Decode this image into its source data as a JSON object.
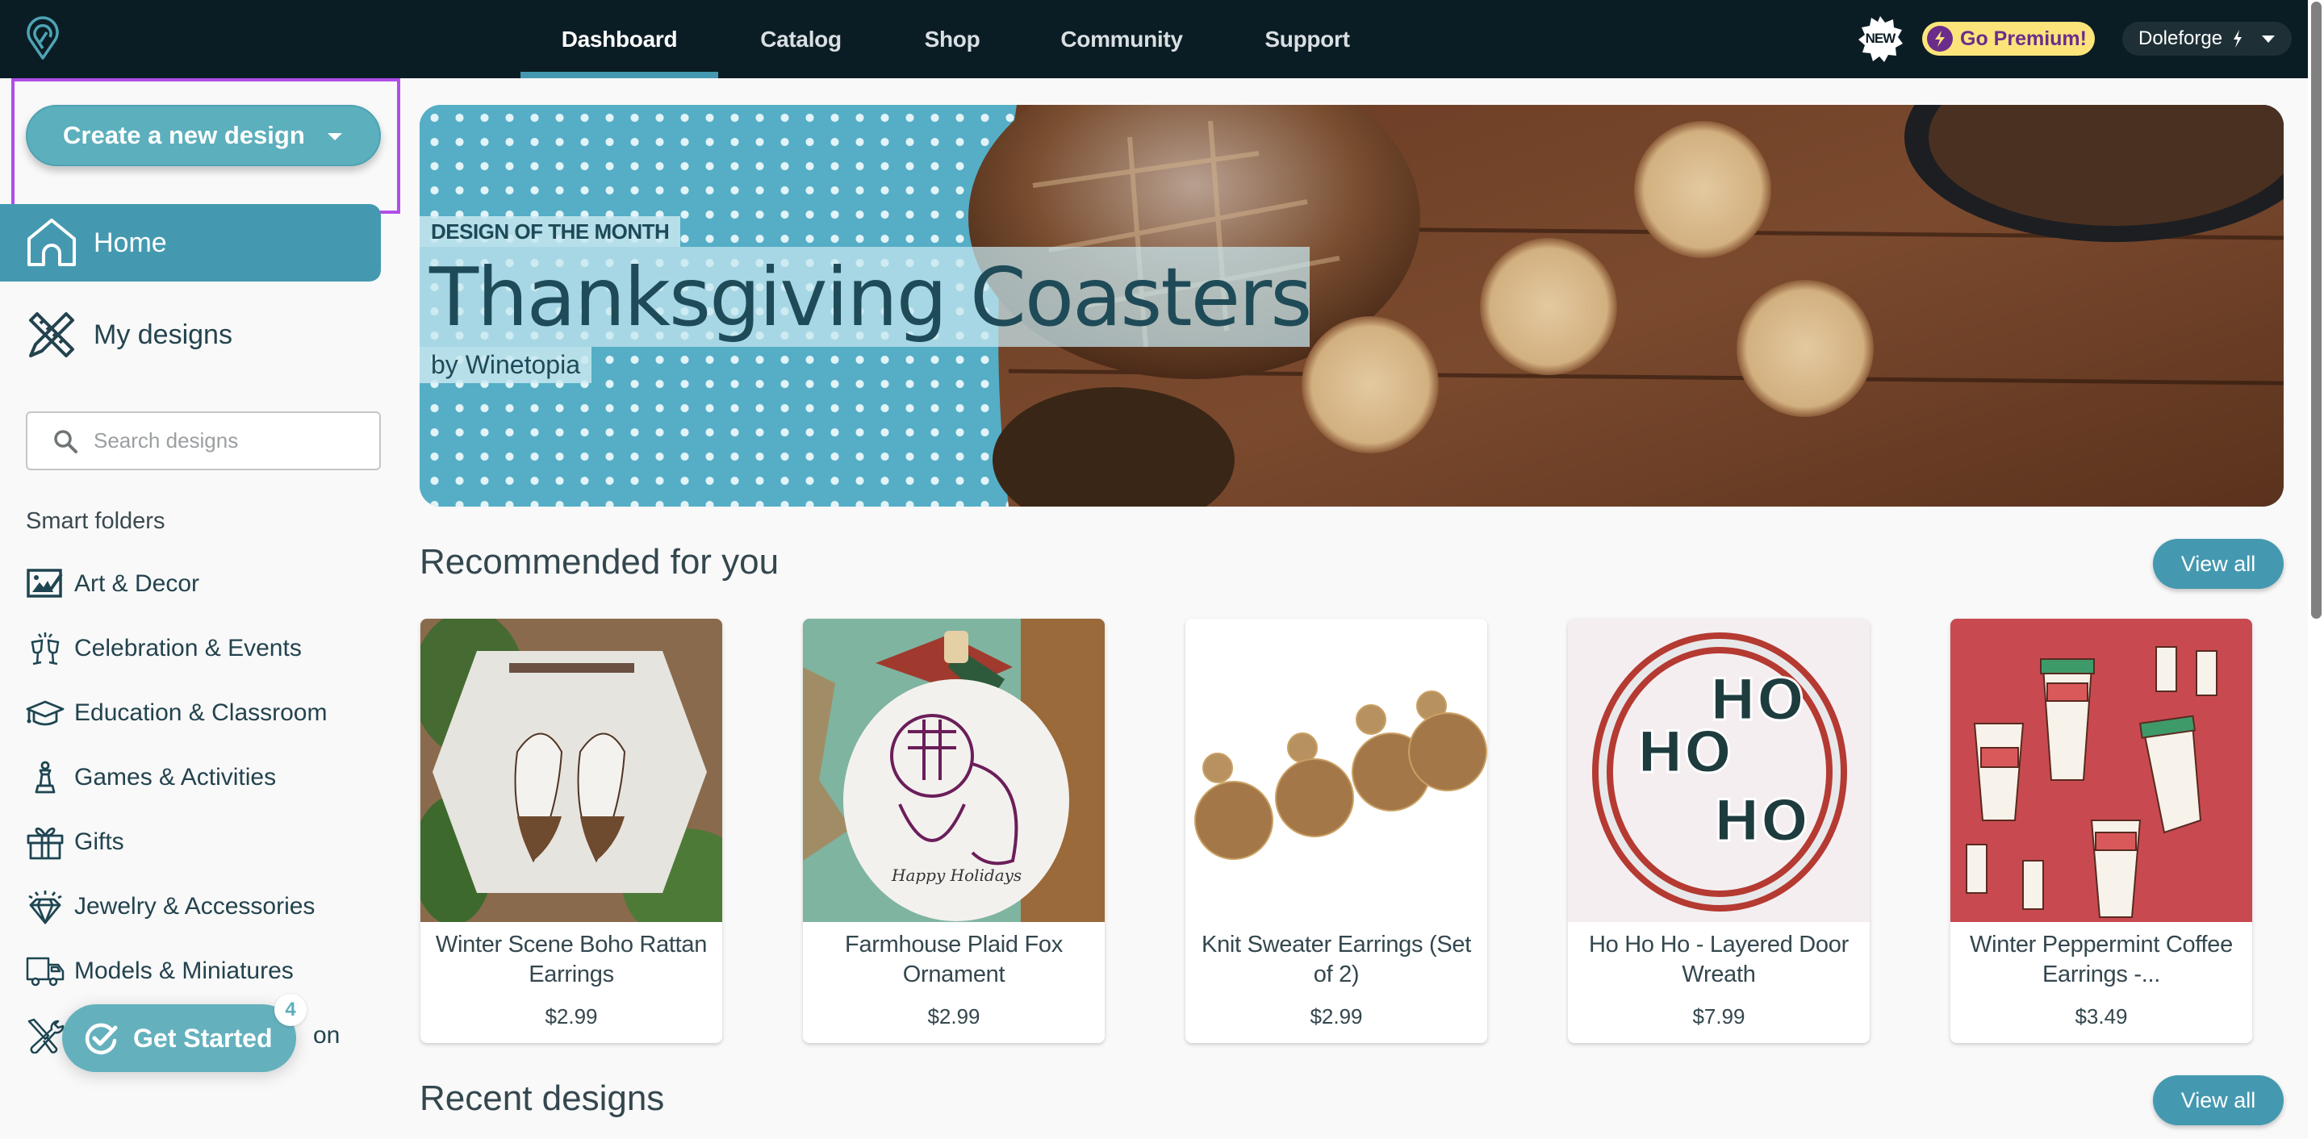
{
  "header": {
    "logo": "pin-logo-icon",
    "nav": [
      {
        "label": "Dashboard",
        "active": true
      },
      {
        "label": "Catalog",
        "active": false
      },
      {
        "label": "Shop",
        "active": false
      },
      {
        "label": "Community",
        "active": false
      },
      {
        "label": "Support",
        "active": false
      }
    ],
    "new_badge": "NEW",
    "premium_label": "Go Premium!",
    "user_name": "Doleforge",
    "user_badge_icon": "lightning-icon"
  },
  "sidebar": {
    "create_button_label": "Create a new design",
    "home_label": "Home",
    "my_designs_label": "My designs",
    "search_placeholder": "Search designs",
    "search_value": "",
    "smart_folders_label": "Smart folders",
    "folders": [
      {
        "label": "Art & Decor",
        "icon": "art-frame-icon"
      },
      {
        "label": "Celebration & Events",
        "icon": "champagne-glasses-icon"
      },
      {
        "label": "Education & Classroom",
        "icon": "graduation-cap-icon"
      },
      {
        "label": "Games & Activities",
        "icon": "chess-piece-icon"
      },
      {
        "label": "Gifts",
        "icon": "gift-icon"
      },
      {
        "label": "Jewelry & Accessories",
        "icon": "diamond-icon"
      },
      {
        "label": "Models & Miniatures",
        "icon": "truck-icon"
      },
      {
        "label": "on",
        "icon": "tools-icon"
      }
    ]
  },
  "get_started": {
    "label": "Get Started",
    "count": "4"
  },
  "banner": {
    "eyebrow": "DESIGN OF THE MONTH",
    "title": "Thanksgiving Coasters",
    "author": "by Winetopia"
  },
  "recommended": {
    "title": "Recommended for you",
    "view_all": "View all",
    "items": [
      {
        "name": "Winter Scene Boho Rattan Earrings",
        "price": "$2.99"
      },
      {
        "name": "Farmhouse Plaid Fox Ornament",
        "price": "$2.99"
      },
      {
        "name": "Knit Sweater Earrings (Set of 2)",
        "price": "$2.99"
      },
      {
        "name": "Ho Ho Ho - Layered Door Wreath",
        "price": "$7.99"
      },
      {
        "name": "Winter Peppermint Coffee Earrings -...",
        "price": "$3.49"
      }
    ]
  },
  "recent": {
    "title": "Recent designs",
    "view_all": "View all"
  },
  "colors": {
    "header_bg": "#0b1d24",
    "accent": "#4499b0",
    "accent_light": "#5cafbc",
    "premium_bg": "#fde47a",
    "premium_text": "#6b2d8b",
    "text_dark": "#23434e",
    "highlight": "#b04ee8"
  }
}
